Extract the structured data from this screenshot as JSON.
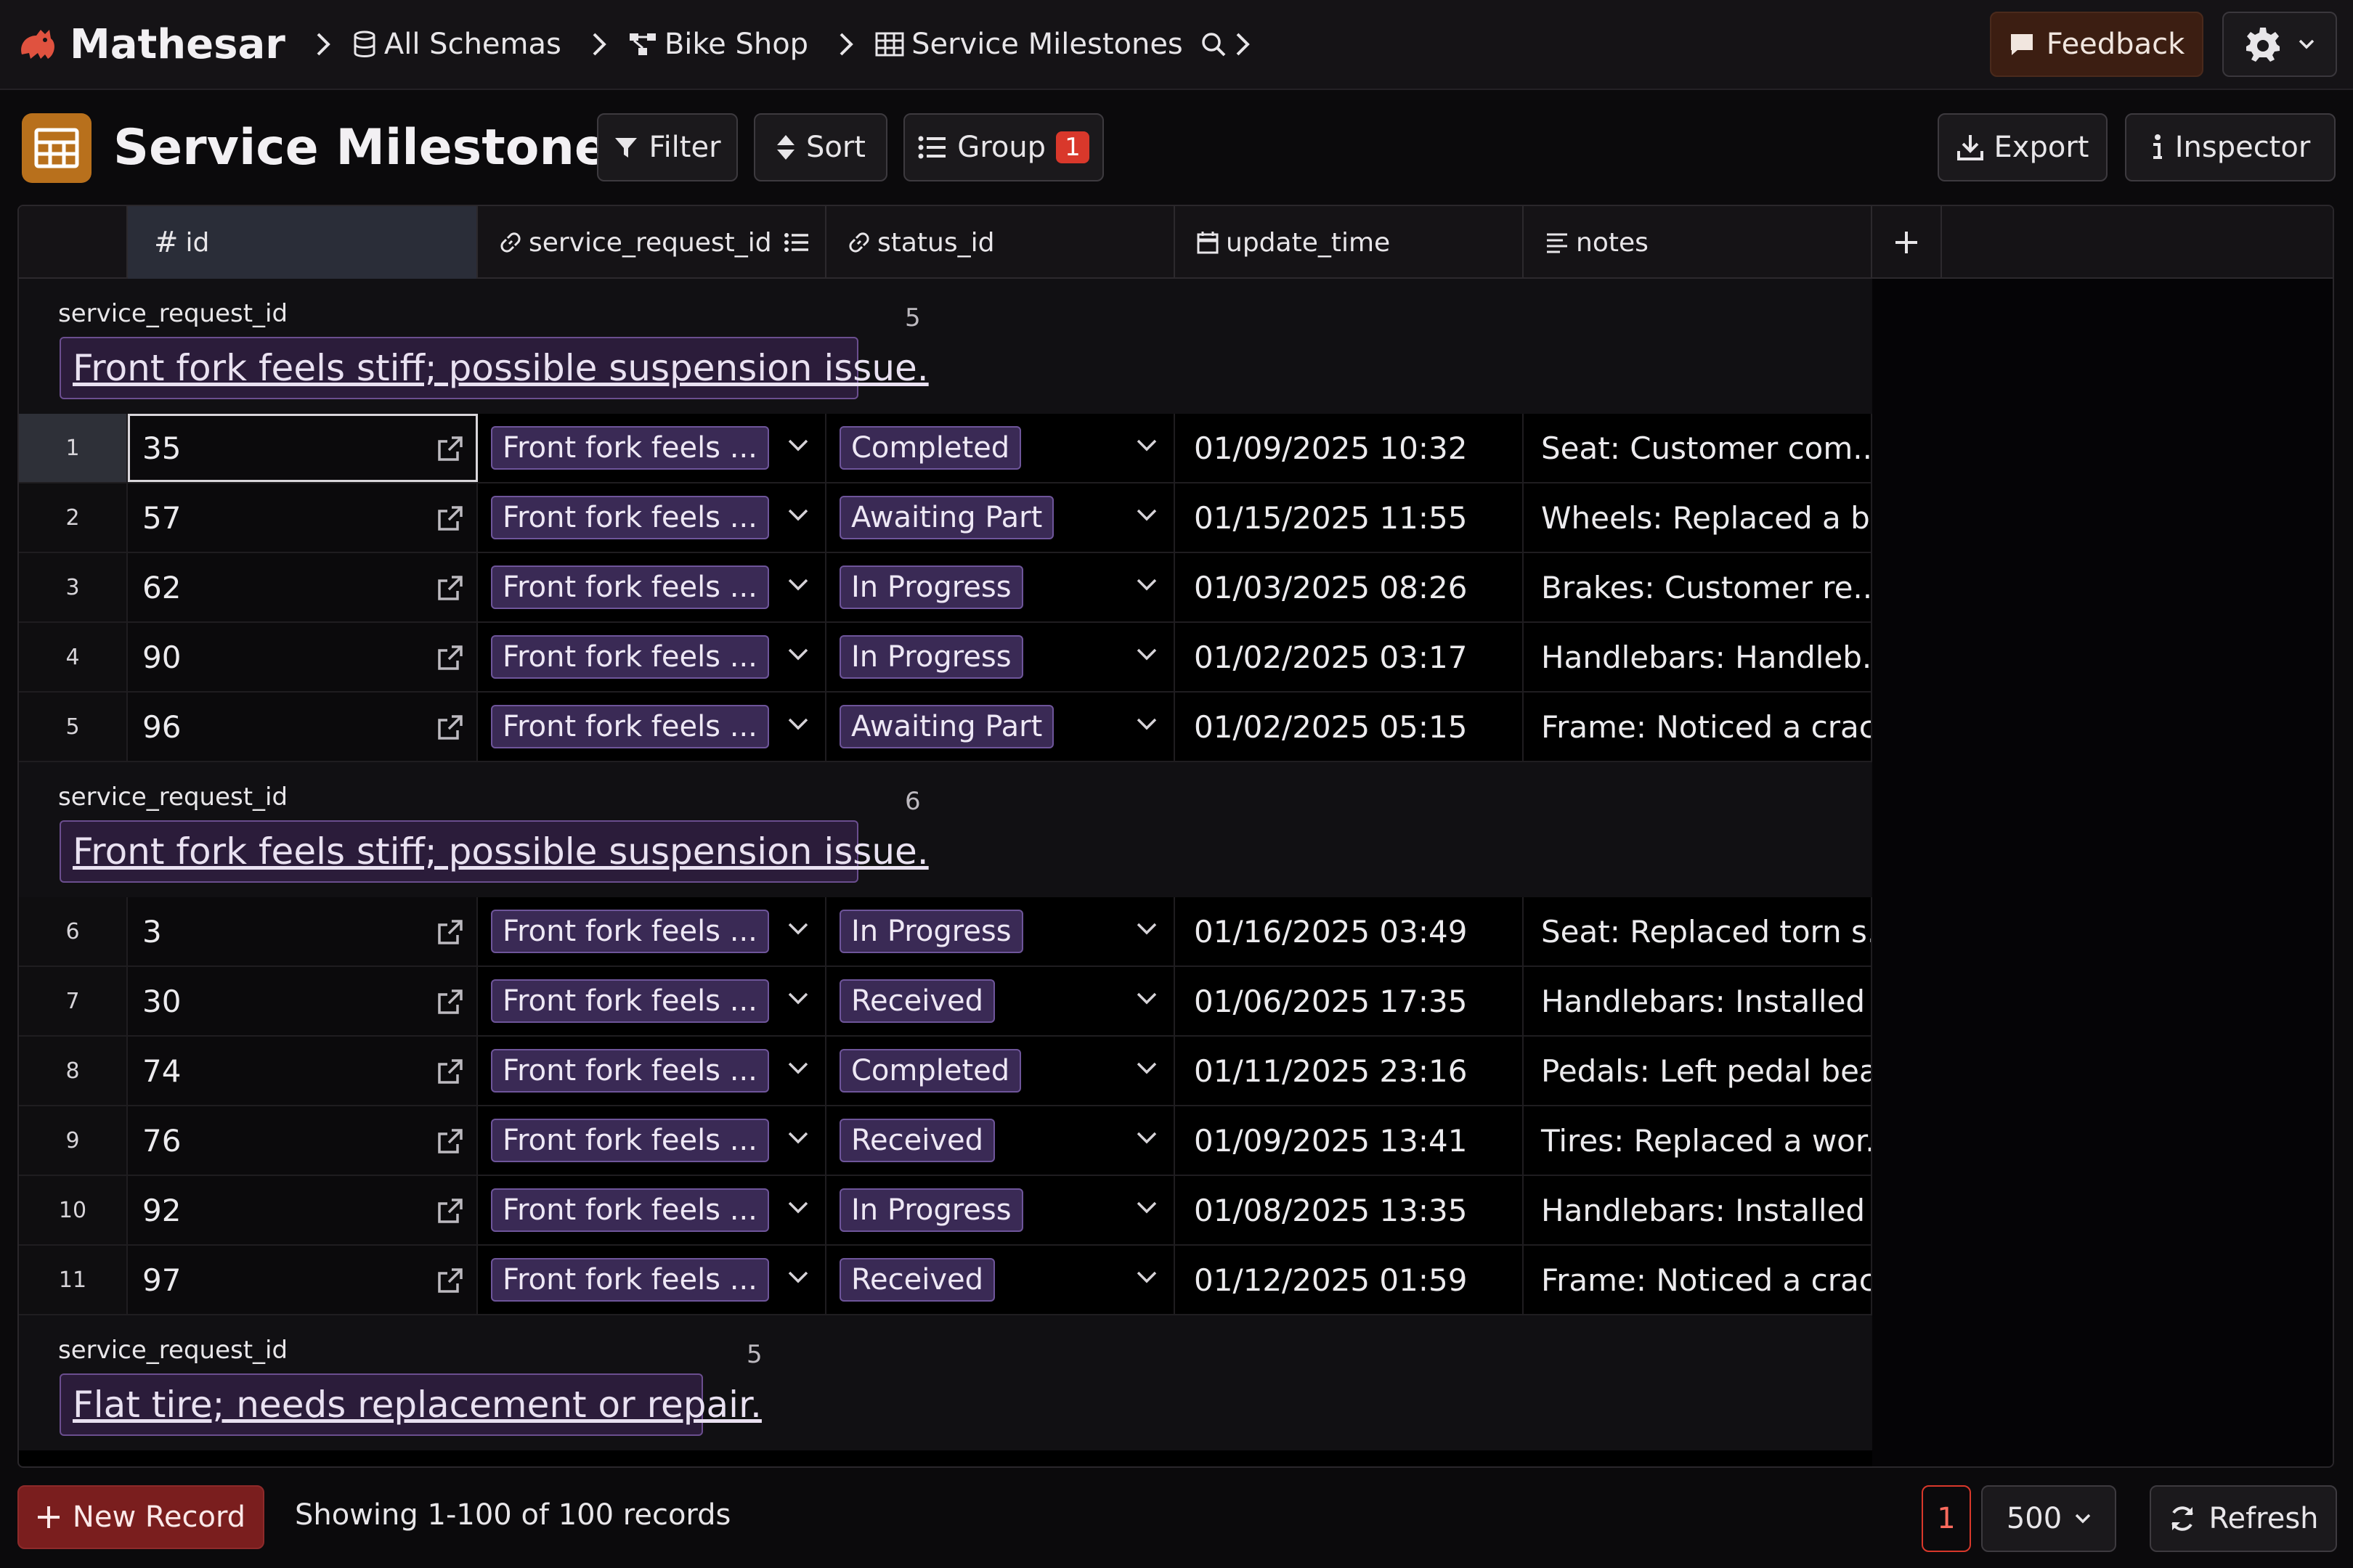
{
  "nav": {
    "app_name": "Mathesar",
    "breadcrumbs": [
      "All Schemas",
      "Bike Shop",
      "Service Milestones"
    ],
    "feedback_label": "Feedback"
  },
  "toolbar": {
    "title": "Service Milestones",
    "filter_label": "Filter",
    "sort_label": "Sort",
    "group_label": "Group",
    "group_count": "1",
    "export_label": "Export",
    "inspector_label": "Inspector"
  },
  "columns": [
    {
      "name": "id",
      "icon": "hash-icon"
    },
    {
      "name": "service_request_id",
      "icon": "link-icon"
    },
    {
      "name": "status_id",
      "icon": "link-icon"
    },
    {
      "name": "update_time",
      "icon": "calendar-icon"
    },
    {
      "name": "notes",
      "icon": "text-icon"
    }
  ],
  "groups": [
    {
      "label": "service_request_id",
      "count": "5",
      "value": "Front fork feels stiff; possible suspension issue.",
      "rows": [
        {
          "num": "1",
          "id": "35",
          "sr": "Front fork feels ...",
          "status": "Completed",
          "time": "01/09/2025 10:32",
          "notes": "Seat: Customer com..."
        },
        {
          "num": "2",
          "id": "57",
          "sr": "Front fork feels ...",
          "status": "Awaiting Part",
          "time": "01/15/2025 11:55",
          "notes": "Wheels: Replaced a b..."
        },
        {
          "num": "3",
          "id": "62",
          "sr": "Front fork feels ...",
          "status": "In Progress",
          "time": "01/03/2025 08:26",
          "notes": "Brakes: Customer re..."
        },
        {
          "num": "4",
          "id": "90",
          "sr": "Front fork feels ...",
          "status": "In Progress",
          "time": "01/02/2025 03:17",
          "notes": "Handlebars: Handleb..."
        },
        {
          "num": "5",
          "id": "96",
          "sr": "Front fork feels ...",
          "status": "Awaiting Part",
          "time": "01/02/2025 05:15",
          "notes": "Frame: Noticed a crac..."
        }
      ]
    },
    {
      "label": "service_request_id",
      "count": "6",
      "value": "Front fork feels stiff; possible suspension issue.",
      "rows": [
        {
          "num": "6",
          "id": "3",
          "sr": "Front fork feels ...",
          "status": "In Progress",
          "time": "01/16/2025 03:49",
          "notes": "Seat: Replaced torn s..."
        },
        {
          "num": "7",
          "id": "30",
          "sr": "Front fork feels ...",
          "status": "Received",
          "time": "01/06/2025 17:35",
          "notes": "Handlebars: Installed ..."
        },
        {
          "num": "8",
          "id": "74",
          "sr": "Front fork feels ...",
          "status": "Completed",
          "time": "01/11/2025 23:16",
          "notes": "Pedals: Left pedal bea..."
        },
        {
          "num": "9",
          "id": "76",
          "sr": "Front fork feels ...",
          "status": "Received",
          "time": "01/09/2025 13:41",
          "notes": "Tires: Replaced a wor..."
        },
        {
          "num": "10",
          "id": "92",
          "sr": "Front fork feels ...",
          "status": "In Progress",
          "time": "01/08/2025 13:35",
          "notes": "Handlebars: Installed ..."
        },
        {
          "num": "11",
          "id": "97",
          "sr": "Front fork feels ...",
          "status": "Received",
          "time": "01/12/2025 01:59",
          "notes": "Frame: Noticed a crac..."
        }
      ]
    },
    {
      "label": "service_request_id",
      "count": "5",
      "value": "Flat tire; needs replacement or repair.",
      "rows": []
    }
  ],
  "footer": {
    "new_record_label": "New Record",
    "showing_text": "Showing 1-100 of 100 records",
    "page": "1",
    "page_size": "500",
    "refresh_label": "Refresh"
  },
  "colors": {
    "accent": "#d9382b",
    "pill_bg": "#3a2a55",
    "table_icon": "#b8701c"
  }
}
